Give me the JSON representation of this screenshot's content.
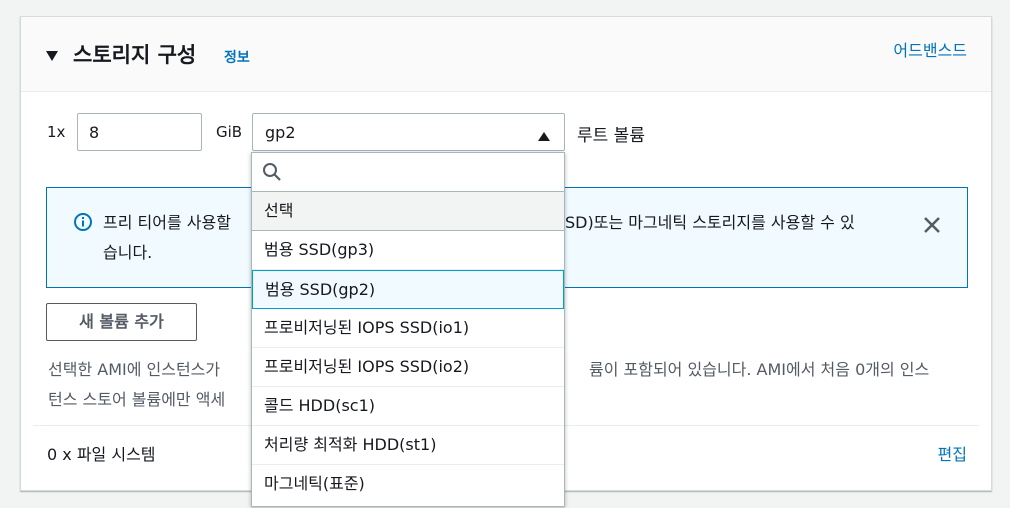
{
  "section": {
    "title": "스토리지 구성",
    "info_link": "정보",
    "advanced_link": "어드밴스드"
  },
  "volume": {
    "quantity_label": "1x",
    "size_value": "8",
    "unit_label": "GiB",
    "type_value": "gp2",
    "root_label": "루트 볼륨"
  },
  "alert": {
    "text_left_line1": "프리 티어를 사용할",
    "text_right_line1": "SD)또는 마그네틱 스토리지를 사용할 수 있",
    "text_line2": "습니다."
  },
  "add_volume_button": "새 볼륨 추가",
  "description": {
    "left_line1": "선택한 AMI에 인스턴스가 ",
    "left_line2": "턴스 스토어 볼륨에만 액세",
    "right_line1": "륨이 포함되어 있습니다. AMI에서 처음 0개의 인스"
  },
  "file_systems": {
    "label": "0 x 파일 시스템",
    "edit_link": "편집"
  },
  "dropdown": {
    "search_value": "",
    "placeholder_option": "선택",
    "options": [
      "범용 SSD(gp3)",
      "범용 SSD(gp2)",
      "프로비저닝된 IOPS SSD(io1)",
      "프로비저닝된 IOPS SSD(io2)",
      "콜드 HDD(sc1)",
      "처리량 최적화 HDD(st1)",
      "마그네틱(표준)"
    ],
    "selected_option": "범용 SSD(gp2)"
  },
  "colors": {
    "link": "#0073bb",
    "alert_bg": "#f1faff",
    "selected_border": "#00a1c9"
  }
}
